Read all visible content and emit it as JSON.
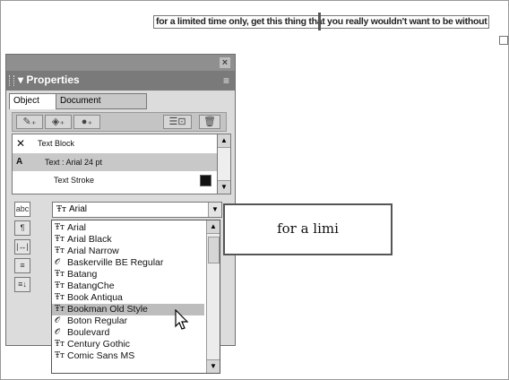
{
  "canvas": {
    "banner_text": "for a limited time only, get this thing that you really wouldn't want to be without"
  },
  "panel": {
    "title": "Properties",
    "tabs": [
      "Object",
      "Document"
    ],
    "toolbar_icons": [
      "pen-plus-icon",
      "fill-plus-icon",
      "effect-plus-icon",
      "list-delete-icon",
      "trash-icon"
    ],
    "objects": [
      {
        "label": "Text Block",
        "icon": "x-icon"
      },
      {
        "label": "Text : Arial 24 pt",
        "icon": "text-a-icon"
      },
      {
        "label": "Text Stroke",
        "icon": "none"
      }
    ],
    "side_buttons": [
      "abc",
      "¶",
      "|↔|",
      "≡",
      "≡↓"
    ],
    "font_selected": "Arial",
    "font_list": [
      {
        "name": "Arial",
        "icon": "truetype-icon"
      },
      {
        "name": "Arial Black",
        "icon": "truetype-icon"
      },
      {
        "name": "Arial Narrow",
        "icon": "truetype-icon"
      },
      {
        "name": "Baskerville BE Regular",
        "icon": "opentype-icon"
      },
      {
        "name": "Batang",
        "icon": "truetype-icon"
      },
      {
        "name": "BatangChe",
        "icon": "truetype-icon"
      },
      {
        "name": "Book Antiqua",
        "icon": "truetype-icon"
      },
      {
        "name": "Bookman Old Style",
        "icon": "truetype-icon"
      },
      {
        "name": "Boton Regular",
        "icon": "opentype-icon"
      },
      {
        "name": "Boulevard",
        "icon": "opentype-icon"
      },
      {
        "name": "Century Gothic",
        "icon": "truetype-icon"
      },
      {
        "name": "Comic Sans MS",
        "icon": "truetype-icon"
      }
    ],
    "highlighted_font": "Bookman Old Style"
  },
  "preview": {
    "text": "for a limi"
  }
}
